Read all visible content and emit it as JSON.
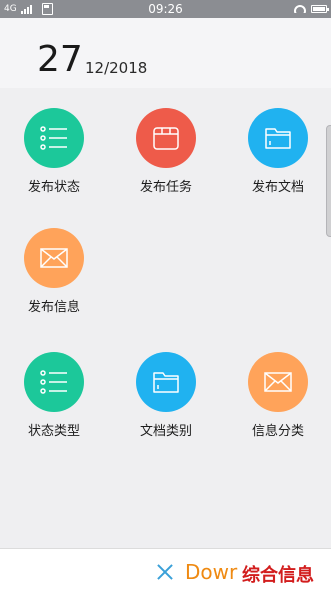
{
  "status_bar": {
    "network": "4G",
    "time": "09:26"
  },
  "header": {
    "day": "27",
    "month_year": "12/2018"
  },
  "tiles": [
    {
      "label": "发布状态",
      "icon": "list-icon",
      "color": "#1cc89a"
    },
    {
      "label": "发布任务",
      "icon": "calendar-icon",
      "color": "#ee5b4a"
    },
    {
      "label": "发布文档",
      "icon": "folder-icon",
      "color": "#20b2f0"
    },
    {
      "label": "发布信息",
      "icon": "mail-icon",
      "color": "#ffa35a"
    },
    {
      "label": "状态类型",
      "icon": "list-icon",
      "color": "#1cc89a"
    },
    {
      "label": "文档类别",
      "icon": "folder-icon",
      "color": "#20b2f0"
    },
    {
      "label": "信息分类",
      "icon": "mail-icon",
      "color": "#ffa35a"
    }
  ],
  "footer": {
    "download_text": "Dowr",
    "watermark_text": "综合信息"
  }
}
